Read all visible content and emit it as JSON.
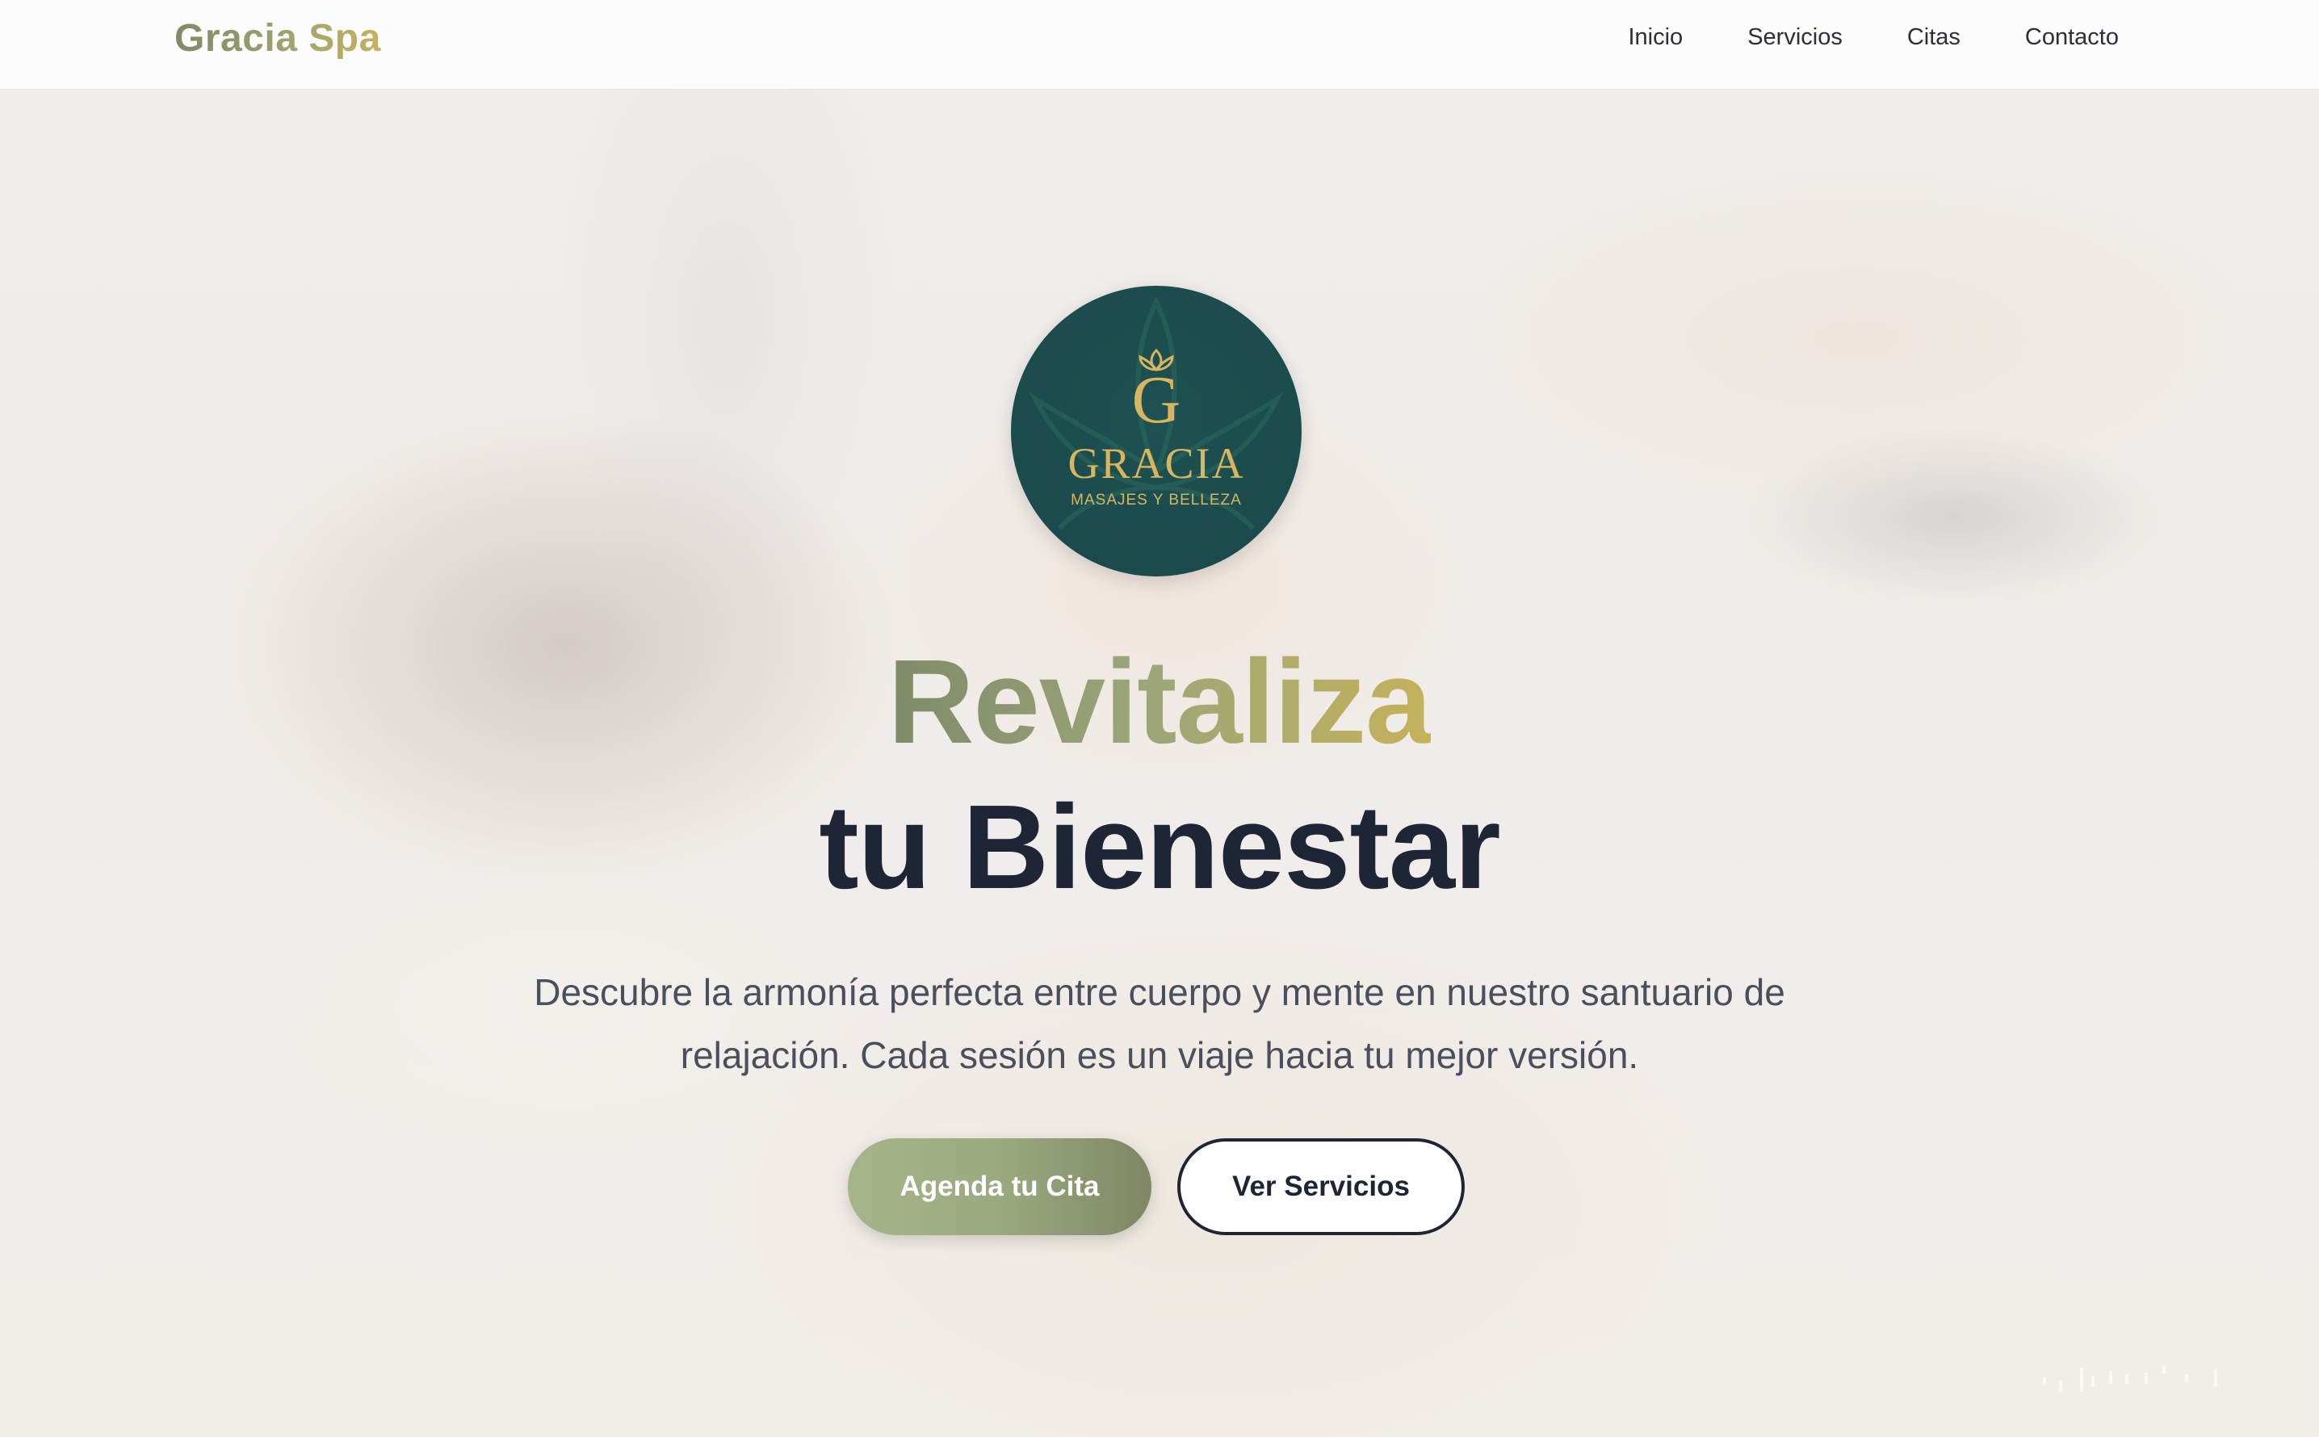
{
  "header": {
    "brand": "Gracia Spa",
    "nav": [
      "Inicio",
      "Servicios",
      "Citas",
      "Contacto"
    ]
  },
  "hero": {
    "logo": {
      "initial": "G",
      "name": "GRACIA",
      "tagline": "MASAJES Y BELLEZA",
      "icon": "lotus-icon"
    },
    "title_line1": "Revitaliza",
    "title_line2": "tu Bienestar",
    "subtitle": "Descubre la armonía perfecta entre cuerpo y mente en nuestro santuario de relajación. Cada sesión es un viaje hacia tu mejor versión.",
    "primary_cta": "Agenda tu Cita",
    "secondary_cta": "Ver Servicios"
  },
  "colors": {
    "brand_gradient_start": "#7f8a68",
    "brand_gradient_end": "#c4b25e",
    "logo_bg": "#1b4b4c",
    "logo_gold": "#d9b65e",
    "dark_text": "#1e2636"
  }
}
